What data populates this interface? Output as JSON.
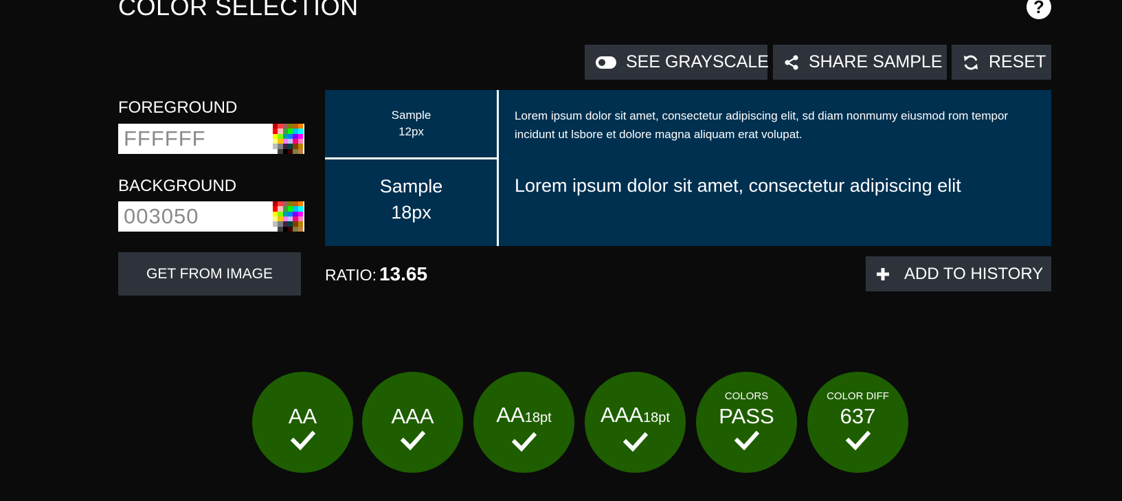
{
  "header": {
    "title": "COLOR SELECTION",
    "help_icon": "help-icon"
  },
  "toolbar": {
    "grayscale_label": "SEE GRAYSCALE",
    "share_label": "SHARE SAMPLE",
    "reset_label": "RESET"
  },
  "inputs": {
    "foreground_label": "FOREGROUND",
    "foreground_value": "FFFFFF",
    "background_label": "BACKGROUND",
    "background_value": "003050",
    "get_from_image_label": "GET FROM IMAGE"
  },
  "sample": {
    "small_label_1": "Sample",
    "small_label_2": "12px",
    "small_text": "Lorem ipsum dolor sit amet, consectetur adipiscing elit, sd diam nonmumy eiusmod rom tempor incidunt ut lsbore et dolore magna aliquam erat volupat.",
    "large_label_1": "Sample",
    "large_label_2": "18px",
    "large_text": "Lorem ipsum dolor sit amet, consectetur adipiscing elit",
    "foreground_color": "#FFFFFF",
    "background_color": "#003050"
  },
  "ratio": {
    "label": "RATIO:",
    "value": "13.65"
  },
  "history": {
    "add_label": "ADD TO HISTORY"
  },
  "results": [
    {
      "top": "",
      "main": "AA",
      "sub": "",
      "status": "pass"
    },
    {
      "top": "",
      "main": "AAA",
      "sub": "",
      "status": "pass"
    },
    {
      "top": "",
      "main": "AA",
      "sub": "18pt",
      "status": "pass"
    },
    {
      "top": "",
      "main": "AAA",
      "sub": "18pt",
      "status": "pass"
    },
    {
      "top": "COLORS",
      "main": "PASS",
      "sub": "",
      "status": "pass"
    },
    {
      "top": "COLOR DIFF",
      "main": "637",
      "sub": "",
      "status": "pass"
    }
  ],
  "colors": {
    "page_bg": "#0b0b0b",
    "button_bg": "#2e333b",
    "pass_green": "#1e5e00",
    "sample_bg": "#003050"
  }
}
